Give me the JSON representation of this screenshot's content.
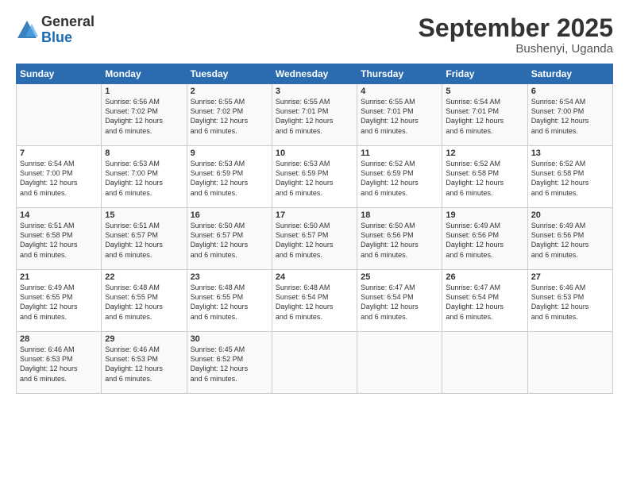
{
  "logo": {
    "general": "General",
    "blue": "Blue"
  },
  "title": "September 2025",
  "location": "Bushenyi, Uganda",
  "headers": [
    "Sunday",
    "Monday",
    "Tuesday",
    "Wednesday",
    "Thursday",
    "Friday",
    "Saturday"
  ],
  "rows": [
    [
      {
        "day": "",
        "info": ""
      },
      {
        "day": "1",
        "info": "Sunrise: 6:56 AM\nSunset: 7:02 PM\nDaylight: 12 hours\nand 6 minutes."
      },
      {
        "day": "2",
        "info": "Sunrise: 6:55 AM\nSunset: 7:02 PM\nDaylight: 12 hours\nand 6 minutes."
      },
      {
        "day": "3",
        "info": "Sunrise: 6:55 AM\nSunset: 7:01 PM\nDaylight: 12 hours\nand 6 minutes."
      },
      {
        "day": "4",
        "info": "Sunrise: 6:55 AM\nSunset: 7:01 PM\nDaylight: 12 hours\nand 6 minutes."
      },
      {
        "day": "5",
        "info": "Sunrise: 6:54 AM\nSunset: 7:01 PM\nDaylight: 12 hours\nand 6 minutes."
      },
      {
        "day": "6",
        "info": "Sunrise: 6:54 AM\nSunset: 7:00 PM\nDaylight: 12 hours\nand 6 minutes."
      }
    ],
    [
      {
        "day": "7",
        "info": "Sunrise: 6:54 AM\nSunset: 7:00 PM\nDaylight: 12 hours\nand 6 minutes."
      },
      {
        "day": "8",
        "info": "Sunrise: 6:53 AM\nSunset: 7:00 PM\nDaylight: 12 hours\nand 6 minutes."
      },
      {
        "day": "9",
        "info": "Sunrise: 6:53 AM\nSunset: 6:59 PM\nDaylight: 12 hours\nand 6 minutes."
      },
      {
        "day": "10",
        "info": "Sunrise: 6:53 AM\nSunset: 6:59 PM\nDaylight: 12 hours\nand 6 minutes."
      },
      {
        "day": "11",
        "info": "Sunrise: 6:52 AM\nSunset: 6:59 PM\nDaylight: 12 hours\nand 6 minutes."
      },
      {
        "day": "12",
        "info": "Sunrise: 6:52 AM\nSunset: 6:58 PM\nDaylight: 12 hours\nand 6 minutes."
      },
      {
        "day": "13",
        "info": "Sunrise: 6:52 AM\nSunset: 6:58 PM\nDaylight: 12 hours\nand 6 minutes."
      }
    ],
    [
      {
        "day": "14",
        "info": "Sunrise: 6:51 AM\nSunset: 6:58 PM\nDaylight: 12 hours\nand 6 minutes."
      },
      {
        "day": "15",
        "info": "Sunrise: 6:51 AM\nSunset: 6:57 PM\nDaylight: 12 hours\nand 6 minutes."
      },
      {
        "day": "16",
        "info": "Sunrise: 6:50 AM\nSunset: 6:57 PM\nDaylight: 12 hours\nand 6 minutes."
      },
      {
        "day": "17",
        "info": "Sunrise: 6:50 AM\nSunset: 6:57 PM\nDaylight: 12 hours\nand 6 minutes."
      },
      {
        "day": "18",
        "info": "Sunrise: 6:50 AM\nSunset: 6:56 PM\nDaylight: 12 hours\nand 6 minutes."
      },
      {
        "day": "19",
        "info": "Sunrise: 6:49 AM\nSunset: 6:56 PM\nDaylight: 12 hours\nand 6 minutes."
      },
      {
        "day": "20",
        "info": "Sunrise: 6:49 AM\nSunset: 6:56 PM\nDaylight: 12 hours\nand 6 minutes."
      }
    ],
    [
      {
        "day": "21",
        "info": "Sunrise: 6:49 AM\nSunset: 6:55 PM\nDaylight: 12 hours\nand 6 minutes."
      },
      {
        "day": "22",
        "info": "Sunrise: 6:48 AM\nSunset: 6:55 PM\nDaylight: 12 hours\nand 6 minutes."
      },
      {
        "day": "23",
        "info": "Sunrise: 6:48 AM\nSunset: 6:55 PM\nDaylight: 12 hours\nand 6 minutes."
      },
      {
        "day": "24",
        "info": "Sunrise: 6:48 AM\nSunset: 6:54 PM\nDaylight: 12 hours\nand 6 minutes."
      },
      {
        "day": "25",
        "info": "Sunrise: 6:47 AM\nSunset: 6:54 PM\nDaylight: 12 hours\nand 6 minutes."
      },
      {
        "day": "26",
        "info": "Sunrise: 6:47 AM\nSunset: 6:54 PM\nDaylight: 12 hours\nand 6 minutes."
      },
      {
        "day": "27",
        "info": "Sunrise: 6:46 AM\nSunset: 6:53 PM\nDaylight: 12 hours\nand 6 minutes."
      }
    ],
    [
      {
        "day": "28",
        "info": "Sunrise: 6:46 AM\nSunset: 6:53 PM\nDaylight: 12 hours\nand 6 minutes."
      },
      {
        "day": "29",
        "info": "Sunrise: 6:46 AM\nSunset: 6:53 PM\nDaylight: 12 hours\nand 6 minutes."
      },
      {
        "day": "30",
        "info": "Sunrise: 6:45 AM\nSunset: 6:52 PM\nDaylight: 12 hours\nand 6 minutes."
      },
      {
        "day": "",
        "info": ""
      },
      {
        "day": "",
        "info": ""
      },
      {
        "day": "",
        "info": ""
      },
      {
        "day": "",
        "info": ""
      }
    ]
  ]
}
